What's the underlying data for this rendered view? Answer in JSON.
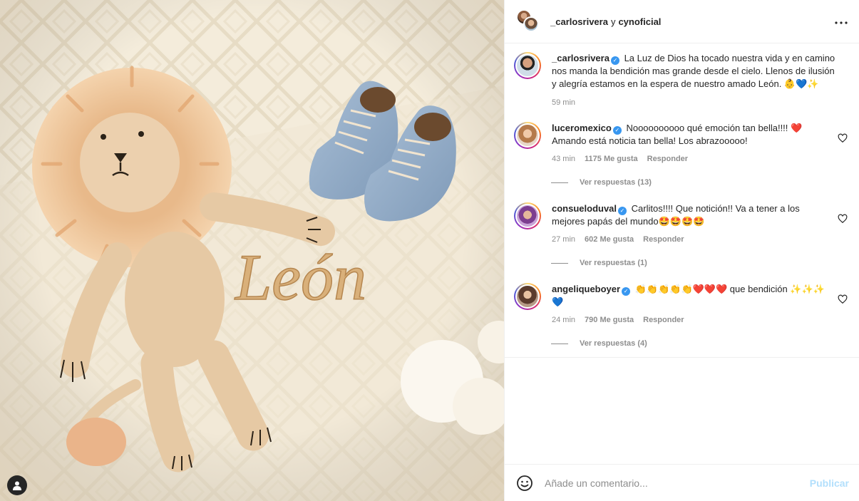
{
  "image": {
    "alt_text": "León"
  },
  "header": {
    "user1": "_carlosrivera",
    "joiner": "y",
    "user2": "cynoficial"
  },
  "caption": {
    "username": "_carlosrivera",
    "text": "La Luz de Dios ha tocado nuestra vida y en camino nos manda la bendición mas grande desde el cielo. Llenos de ilusión y alegría estamos en la espera de nuestro amado León. 👶💙✨",
    "time": "59 min"
  },
  "comments": [
    {
      "username": "luceromexico",
      "text": "Noooooooooo qué emoción tan bella!!!! ❤️ Amando está noticia tan bella! Los abrazooooo!",
      "time": "43 min",
      "likes": "1175 Me gusta",
      "reply": "Responder",
      "view_replies": "Ver respuestas (13)"
    },
    {
      "username": "consueloduval",
      "text": "Carlitos!!!! Que notición!! Va a tener a los mejores papás del mundo🤩🤩🤩🤩",
      "time": "27 min",
      "likes": "602 Me gusta",
      "reply": "Responder",
      "view_replies": "Ver respuestas (1)"
    },
    {
      "username": "angeliqueboyer",
      "text": "👏👏👏👏👏❤️❤️❤️ que bendición ✨✨✨💙",
      "time": "24 min",
      "likes": "790 Me gusta",
      "reply": "Responder",
      "view_replies": "Ver respuestas (4)"
    }
  ],
  "footer": {
    "placeholder": "Añade un comentario...",
    "publish": "Publicar"
  },
  "icons": {
    "more": "more-options-icon",
    "heart": "heart-outline-icon",
    "emoji": "emoji-smile-icon",
    "user": "user-tag-icon"
  },
  "colors": {
    "link_blue": "#b2dffc",
    "verified": "#3897f0",
    "meta_gray": "#8e8e8e"
  }
}
